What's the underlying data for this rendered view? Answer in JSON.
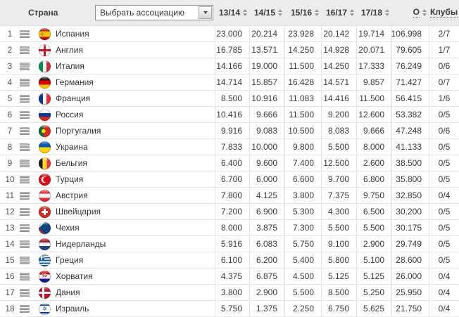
{
  "header": {
    "country_label": "Страна",
    "association_select": {
      "value": "Выбрать ассоциацию"
    },
    "season_columns": [
      "13/14",
      "14/15",
      "15/16",
      "16/17",
      "17/18"
    ],
    "total_label": "О",
    "clubs_label": "Клубы"
  },
  "icons": {
    "stats_icon": "three-horizontal-bars",
    "sort_icon": "up-down-triangles",
    "select_arrow": "down-triangle"
  },
  "colors": {
    "header_bg": "#ececec",
    "row_border": "#e3e3e3",
    "text": "#333333",
    "sort_arrow": "#9a9a9a"
  },
  "rows": [
    {
      "rank": "1",
      "flag": "es",
      "country": "Испания",
      "seasons": [
        "23.000",
        "20.214",
        "23.928",
        "20.142",
        "19.714"
      ],
      "total": "106.998",
      "clubs": "2/7"
    },
    {
      "rank": "2",
      "flag": "en",
      "country": "Англия",
      "seasons": [
        "16.785",
        "13.571",
        "14.250",
        "14.928",
        "20.071"
      ],
      "total": "79.605",
      "clubs": "1/7"
    },
    {
      "rank": "3",
      "flag": "it",
      "country": "Италия",
      "seasons": [
        "14.166",
        "19.000",
        "11.500",
        "14.250",
        "17.333"
      ],
      "total": "76.249",
      "clubs": "0/6"
    },
    {
      "rank": "4",
      "flag": "de",
      "country": "Германия",
      "seasons": [
        "14.714",
        "15.857",
        "16.428",
        "14.571",
        "9.857"
      ],
      "total": "71.427",
      "clubs": "0/7"
    },
    {
      "rank": "5",
      "flag": "fr",
      "country": "Франция",
      "seasons": [
        "8.500",
        "10.916",
        "11.083",
        "14.416",
        "11.500"
      ],
      "total": "56.415",
      "clubs": "1/6"
    },
    {
      "rank": "6",
      "flag": "ru",
      "country": "Россия",
      "seasons": [
        "10.416",
        "9.666",
        "11.500",
        "9.200",
        "12.600"
      ],
      "total": "53.382",
      "clubs": "0/5"
    },
    {
      "rank": "7",
      "flag": "pt",
      "country": "Португалия",
      "seasons": [
        "9.916",
        "9.083",
        "10.500",
        "8.083",
        "9.666"
      ],
      "total": "47.248",
      "clubs": "0/6"
    },
    {
      "rank": "8",
      "flag": "ua",
      "country": "Украина",
      "seasons": [
        "7.833",
        "10.000",
        "9.800",
        "5.500",
        "8.000"
      ],
      "total": "41.133",
      "clubs": "0/5"
    },
    {
      "rank": "9",
      "flag": "be",
      "country": "Бельгия",
      "seasons": [
        "6.400",
        "9.600",
        "7.400",
        "12.500",
        "2.600"
      ],
      "total": "38.500",
      "clubs": "0/5"
    },
    {
      "rank": "10",
      "flag": "tr",
      "country": "Турция",
      "seasons": [
        "6.700",
        "6.000",
        "6.600",
        "9.700",
        "6.800"
      ],
      "total": "35.800",
      "clubs": "0/5"
    },
    {
      "rank": "11",
      "flag": "at",
      "country": "Австрия",
      "seasons": [
        "7.800",
        "4.125",
        "3.800",
        "7.375",
        "9.750"
      ],
      "total": "32.850",
      "clubs": "0/4"
    },
    {
      "rank": "12",
      "flag": "ch",
      "country": "Швейцария",
      "seasons": [
        "7.200",
        "6.900",
        "5.300",
        "4.300",
        "6.500"
      ],
      "total": "30.200",
      "clubs": "0/5"
    },
    {
      "rank": "13",
      "flag": "cz",
      "country": "Чехия",
      "seasons": [
        "8.000",
        "3.875",
        "7.300",
        "5.500",
        "5.500"
      ],
      "total": "30.175",
      "clubs": "0/5"
    },
    {
      "rank": "14",
      "flag": "nl",
      "country": "Нидерланды",
      "seasons": [
        "5.916",
        "6.083",
        "5.750",
        "9.100",
        "2.900"
      ],
      "total": "29.749",
      "clubs": "0/5"
    },
    {
      "rank": "15",
      "flag": "gr",
      "country": "Греция",
      "seasons": [
        "6.100",
        "6.200",
        "5.400",
        "5.800",
        "5.100"
      ],
      "total": "28.600",
      "clubs": "0/5"
    },
    {
      "rank": "16",
      "flag": "hr",
      "country": "Хорватия",
      "seasons": [
        "4.375",
        "6.875",
        "4.500",
        "5.125",
        "5.125"
      ],
      "total": "26.000",
      "clubs": "0/4"
    },
    {
      "rank": "17",
      "flag": "dk",
      "country": "Дания",
      "seasons": [
        "3.800",
        "2.900",
        "5.500",
        "8.500",
        "5.250"
      ],
      "total": "25.950",
      "clubs": "0/4"
    },
    {
      "rank": "18",
      "flag": "il",
      "country": "Израиль",
      "seasons": [
        "5.750",
        "1.375",
        "2.250",
        "6.750",
        "5.625"
      ],
      "total": "21.750",
      "clubs": "0/4"
    }
  ]
}
